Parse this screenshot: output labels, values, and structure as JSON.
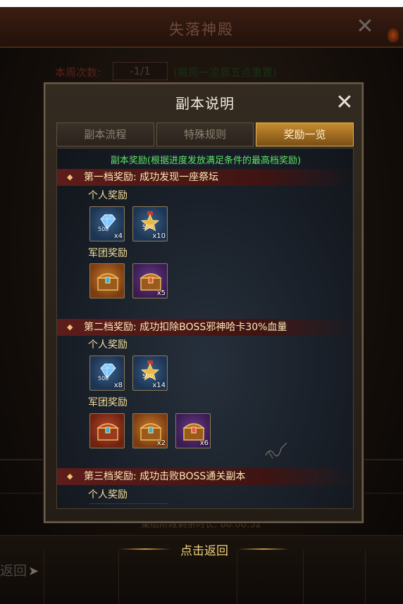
{
  "header": {
    "title": "失落神殿"
  },
  "week": {
    "label": "本周次数:",
    "value": "-1/1",
    "note": "(每周一凌晨五点重置)"
  },
  "end_time": "集结阶段剩余时长: 00:00:52",
  "bottom": {
    "back_label": "返回",
    "return_label": "点击返回"
  },
  "dialog": {
    "title": "副本说明",
    "tabs": [
      {
        "label": "副本流程",
        "active": false
      },
      {
        "label": "特殊规则",
        "active": false
      },
      {
        "label": "奖励一览",
        "active": true
      }
    ],
    "notice": "副本奖励(根据进度发放满足条件的最高档奖励)",
    "tiers": [
      {
        "title": "第一档奖励: 成功发现一座祭坛",
        "personal_label": "个人奖励",
        "personal": [
          {
            "icon": "diamond-icon",
            "value": "500",
            "qty": "x4"
          },
          {
            "icon": "medal-icon",
            "value": "500",
            "qty": "x10"
          }
        ],
        "legion_label": "军团奖励",
        "legion": [
          {
            "icon": "gold-chest-icon",
            "qty": ""
          },
          {
            "icon": "purple-chest-icon",
            "qty": "x5"
          }
        ]
      },
      {
        "title": "第二档奖励: 成功扣除BOSS邪神哈卡30%血量",
        "personal_label": "个人奖励",
        "personal": [
          {
            "icon": "diamond-icon",
            "value": "500",
            "qty": "x8"
          },
          {
            "icon": "medal-icon",
            "value": "500",
            "qty": "x14"
          }
        ],
        "legion_label": "军团奖励",
        "legion": [
          {
            "icon": "red-chest-icon",
            "qty": ""
          },
          {
            "icon": "gold-chest-icon",
            "qty": "x2"
          },
          {
            "icon": "purple-chest-icon",
            "qty": "x6"
          }
        ]
      },
      {
        "title": "第三档奖励: 成功击败BOSS通关副本",
        "personal_label": "个人奖励"
      }
    ]
  },
  "colors": {
    "tab_active": "#c88d30",
    "notice": "#5fe26a",
    "tier_banner": "#5e1d1a",
    "label": "#f4df9c"
  }
}
